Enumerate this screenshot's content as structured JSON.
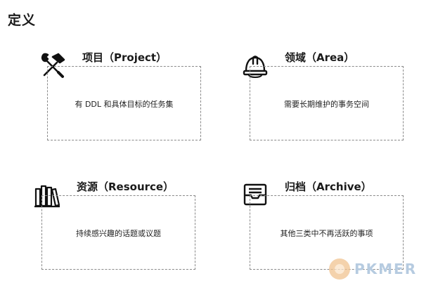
{
  "page": {
    "title": "定义"
  },
  "cards": [
    {
      "title": "项目（Project）",
      "description": "有 DDL 和具体目标的任务集",
      "icon": "tools-icon"
    },
    {
      "title": "领域（Area）",
      "description": "需要长期维护的事务空间",
      "icon": "hard-hat-icon"
    },
    {
      "title": "资源（Resource）",
      "description": "持续感兴趣的话题或议题",
      "icon": "books-icon"
    },
    {
      "title": "归档（Archive）",
      "description": "其他三类中不再活跃的事项",
      "icon": "archive-tray-icon"
    }
  ],
  "watermark": {
    "text": "PKMER"
  }
}
